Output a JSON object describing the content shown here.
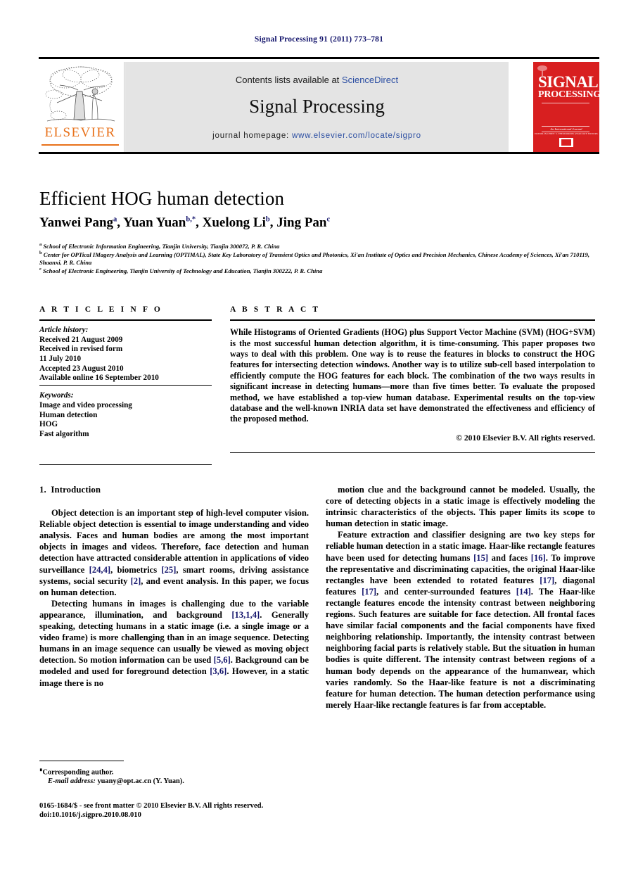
{
  "running_head": "Signal Processing 91 (2011) 773–781",
  "masthead": {
    "contents_prefix": "Contents lists available at ",
    "contents_link": "ScienceDirect",
    "journal_name": "Signal Processing",
    "homepage_prefix": "journal homepage: ",
    "homepage_url": "www.elsevier.com/locate/sigpro",
    "publisher_name": "ELSEVIER",
    "cover": {
      "line1": "SIGNAL",
      "line2": "PROCESSING",
      "sub": "An International Journal",
      "sub2": "EDITOR-IN-CHIEF: S. THEODORIDIS   ASSOCIATE EDITORS"
    }
  },
  "article": {
    "title": "Efficient HOG human detection",
    "authors": [
      {
        "name": "Yanwei Pang",
        "sup": "a",
        "sep": ", "
      },
      {
        "name": "Yuan Yuan",
        "sup": "b,*",
        "sep": ", "
      },
      {
        "name": "Xuelong Li",
        "sup": "b",
        "sep": ", "
      },
      {
        "name": "Jing Pan",
        "sup": "c",
        "sep": ""
      }
    ],
    "affiliations": [
      {
        "mark": "a",
        "text": "School of Electronic Information Engineering, Tianjin University, Tianjin 300072, P. R. China"
      },
      {
        "mark": "b",
        "text": "Center for OPTical IMagery Analysis and Learning (OPTIMAL), State Key Laboratory of Transient Optics and Photonics, Xi'an Institute of Optics and Precision Mechanics, Chinese Academy of Sciences, Xi'an 710119, Shaanxi, P. R. China"
      },
      {
        "mark": "c",
        "text": "School of Electronic Engineering, Tianjin University of Technology and Education, Tianjin 300222, P. R. China"
      }
    ]
  },
  "article_info": {
    "heading": "A R T I C L E   I N F O",
    "history_label": "Article history:",
    "history": [
      "Received 21 August 2009",
      "Received in revised form",
      "11 July 2010",
      "Accepted 23 August 2010",
      "Available online 16 September 2010"
    ],
    "keywords_label": "Keywords:",
    "keywords": [
      "Image and video processing",
      "Human detection",
      "HOG",
      "Fast algorithm"
    ]
  },
  "abstract": {
    "heading": "A B S T R A C T",
    "text": "While Histograms of Oriented Gradients (HOG) plus Support Vector Machine (SVM) (HOG+SVM) is the most successful human detection algorithm, it is time-consuming. This paper proposes two ways to deal with this problem. One way is to reuse the features in blocks to construct the HOG features for intersecting detection windows. Another way is to utilize sub-cell based interpolation to efficiently compute the HOG features for each block. The combination of the two ways results in significant increase in detecting humans—more than five times better. To evaluate the proposed method, we have established a top-view human database. Experimental results on the top-view database and the well-known INRIA data set have demonstrated the effectiveness and efficiency of the proposed method.",
    "copyright": "© 2010 Elsevier B.V. All rights reserved."
  },
  "body": {
    "section_number": "1.",
    "section_title": "Introduction",
    "left_paragraphs": [
      "Object detection is an important step of high-level computer vision. Reliable object detection is essential to image understanding and video analysis. Faces and human bodies are among the most important objects in images and videos. Therefore, face detection and human detection have attracted considerable attention in applications of video surveillance [24,4], biometrics [25], smart rooms, driving assistance systems, social security [2], and event analysis. In this paper, we focus on human detection.",
      "Detecting humans in images is challenging due to the variable appearance, illumination, and background [13,1,4]. Generally speaking, detecting humans in a static image (i.e. a single image or a video frame) is more challenging than in an image sequence. Detecting humans in an image sequence can usually be viewed as moving object detection. So motion information can be used [5,6]. Background can be modeled and used for foreground detection [3,6]. However, in a static image there is no"
    ],
    "right_paragraphs": [
      "motion clue and the background cannot be modeled. Usually, the core of detecting objects in a static image is effectively modeling the intrinsic characteristics of the objects. This paper limits its scope to human detection in static image.",
      "Feature extraction and classifier designing are two key steps for reliable human detection in a static image. Haar-like rectangle features have been used for detecting humans [15] and faces [16]. To improve the representative and discriminating capacities, the original Haar-like rectangles have been extended to rotated features [17], diagonal features [17], and center-surrounded features [14]. The Haar-like rectangle features encode the intensity contrast between neighboring regions. Such features are suitable for face detection. All frontal faces have similar facial components and the facial components have fixed neighboring relationship. Importantly, the intensity contrast between neighboring facial parts is relatively stable. But the situation in human bodies is quite different. The intensity contrast between regions of a human body depends on the appearance of the humanwear, which varies randomly. So the Haar-like feature is not a discriminating feature for human detection. The human detection performance using merely Haar-like rectangle features is far from acceptable."
    ]
  },
  "footnotes": {
    "corresponding": "Corresponding author.",
    "email_label": "E-mail address:",
    "email_value": "yuany@opt.ac.cn (Y. Yuan)."
  },
  "imprint": {
    "line1": "0165-1684/$ - see front matter © 2010 Elsevier B.V. All rights reserved.",
    "line2": "doi:10.1016/j.sigpro.2010.08.010"
  },
  "colors": {
    "link": "#2b4ea2",
    "reference": "#12136b",
    "elsevier_orange": "#e8711a",
    "cover_red": "#d81f20",
    "masthead_grey": "#e4e4e4"
  }
}
